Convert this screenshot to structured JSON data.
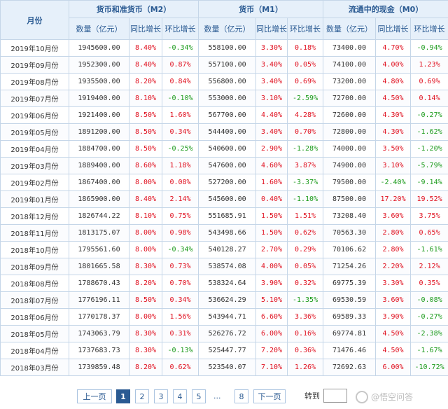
{
  "table": {
    "headers": {
      "month": "月份",
      "m2": "货币和准货币（M2）",
      "m1": "货币（M1）",
      "m0": "流通中的现金（M0）",
      "quantity": "数量（亿元）",
      "yoy": "同比增长",
      "mom": "环比增长"
    },
    "rows": [
      {
        "month": "2019年10月份",
        "m2": "1945600.00",
        "m2_yoy": "8.40%",
        "m2_mom": "-0.34%",
        "m1": "558100.00",
        "m1_yoy": "3.30%",
        "m1_mom": "0.18%",
        "m0": "73400.00",
        "m0_yoy": "4.70%",
        "m0_mom": "-0.94%"
      },
      {
        "month": "2019年09月份",
        "m2": "1952300.00",
        "m2_yoy": "8.40%",
        "m2_mom": "0.87%",
        "m1": "557100.00",
        "m1_yoy": "3.40%",
        "m1_mom": "0.05%",
        "m0": "74100.00",
        "m0_yoy": "4.00%",
        "m0_mom": "1.23%"
      },
      {
        "month": "2019年08月份",
        "m2": "1935500.00",
        "m2_yoy": "8.20%",
        "m2_mom": "0.84%",
        "m1": "556800.00",
        "m1_yoy": "3.40%",
        "m1_mom": "0.69%",
        "m0": "73200.00",
        "m0_yoy": "4.80%",
        "m0_mom": "0.69%"
      },
      {
        "month": "2019年07月份",
        "m2": "1919400.00",
        "m2_yoy": "8.10%",
        "m2_mom": "-0.10%",
        "m1": "553000.00",
        "m1_yoy": "3.10%",
        "m1_mom": "-2.59%",
        "m0": "72700.00",
        "m0_yoy": "4.50%",
        "m0_mom": "0.14%"
      },
      {
        "month": "2019年06月份",
        "m2": "1921400.00",
        "m2_yoy": "8.50%",
        "m2_mom": "1.60%",
        "m1": "567700.00",
        "m1_yoy": "4.40%",
        "m1_mom": "4.28%",
        "m0": "72600.00",
        "m0_yoy": "4.30%",
        "m0_mom": "-0.27%"
      },
      {
        "month": "2019年05月份",
        "m2": "1891200.00",
        "m2_yoy": "8.50%",
        "m2_mom": "0.34%",
        "m1": "544400.00",
        "m1_yoy": "3.40%",
        "m1_mom": "0.70%",
        "m0": "72800.00",
        "m0_yoy": "4.30%",
        "m0_mom": "-1.62%"
      },
      {
        "month": "2019年04月份",
        "m2": "1884700.00",
        "m2_yoy": "8.50%",
        "m2_mom": "-0.25%",
        "m1": "540600.00",
        "m1_yoy": "2.90%",
        "m1_mom": "-1.28%",
        "m0": "74000.00",
        "m0_yoy": "3.50%",
        "m0_mom": "-1.20%"
      },
      {
        "month": "2019年03月份",
        "m2": "1889400.00",
        "m2_yoy": "8.60%",
        "m2_mom": "1.18%",
        "m1": "547600.00",
        "m1_yoy": "4.60%",
        "m1_mom": "3.87%",
        "m0": "74900.00",
        "m0_yoy": "3.10%",
        "m0_mom": "-5.79%"
      },
      {
        "month": "2019年02月份",
        "m2": "1867400.00",
        "m2_yoy": "8.00%",
        "m2_mom": "0.08%",
        "m1": "527200.00",
        "m1_yoy": "1.60%",
        "m1_mom": "-3.37%",
        "m0": "79500.00",
        "m0_yoy": "-2.40%",
        "m0_mom": "-9.14%"
      },
      {
        "month": "2019年01月份",
        "m2": "1865900.00",
        "m2_yoy": "8.40%",
        "m2_mom": "2.14%",
        "m1": "545600.00",
        "m1_yoy": "0.40%",
        "m1_mom": "-1.10%",
        "m0": "87500.00",
        "m0_yoy": "17.20%",
        "m0_mom": "19.52%"
      },
      {
        "month": "2018年12月份",
        "m2": "1826744.22",
        "m2_yoy": "8.10%",
        "m2_mom": "0.75%",
        "m1": "551685.91",
        "m1_yoy": "1.50%",
        "m1_mom": "1.51%",
        "m0": "73208.40",
        "m0_yoy": "3.60%",
        "m0_mom": "3.75%"
      },
      {
        "month": "2018年11月份",
        "m2": "1813175.07",
        "m2_yoy": "8.00%",
        "m2_mom": "0.98%",
        "m1": "543498.66",
        "m1_yoy": "1.50%",
        "m1_mom": "0.62%",
        "m0": "70563.30",
        "m0_yoy": "2.80%",
        "m0_mom": "0.65%"
      },
      {
        "month": "2018年10月份",
        "m2": "1795561.60",
        "m2_yoy": "8.00%",
        "m2_mom": "-0.34%",
        "m1": "540128.27",
        "m1_yoy": "2.70%",
        "m1_mom": "0.29%",
        "m0": "70106.62",
        "m0_yoy": "2.80%",
        "m0_mom": "-1.61%"
      },
      {
        "month": "2018年09月份",
        "m2": "1801665.58",
        "m2_yoy": "8.30%",
        "m2_mom": "0.73%",
        "m1": "538574.08",
        "m1_yoy": "4.00%",
        "m1_mom": "0.05%",
        "m0": "71254.26",
        "m0_yoy": "2.20%",
        "m0_mom": "2.12%"
      },
      {
        "month": "2018年08月份",
        "m2": "1788670.43",
        "m2_yoy": "8.20%",
        "m2_mom": "0.70%",
        "m1": "538324.64",
        "m1_yoy": "3.90%",
        "m1_mom": "0.32%",
        "m0": "69775.39",
        "m0_yoy": "3.30%",
        "m0_mom": "0.35%"
      },
      {
        "month": "2018年07月份",
        "m2": "1776196.11",
        "m2_yoy": "8.50%",
        "m2_mom": "0.34%",
        "m1": "536624.29",
        "m1_yoy": "5.10%",
        "m1_mom": "-1.35%",
        "m0": "69530.59",
        "m0_yoy": "3.60%",
        "m0_mom": "-0.08%"
      },
      {
        "month": "2018年06月份",
        "m2": "1770178.37",
        "m2_yoy": "8.00%",
        "m2_mom": "1.56%",
        "m1": "543944.71",
        "m1_yoy": "6.60%",
        "m1_mom": "3.36%",
        "m0": "69589.33",
        "m0_yoy": "3.90%",
        "m0_mom": "-0.27%"
      },
      {
        "month": "2018年05月份",
        "m2": "1743063.79",
        "m2_yoy": "8.30%",
        "m2_mom": "0.31%",
        "m1": "526276.72",
        "m1_yoy": "6.00%",
        "m1_mom": "0.16%",
        "m0": "69774.81",
        "m0_yoy": "4.50%",
        "m0_mom": "-2.38%"
      },
      {
        "month": "2018年04月份",
        "m2": "1737683.73",
        "m2_yoy": "8.30%",
        "m2_mom": "-0.13%",
        "m1": "525447.77",
        "m1_yoy": "7.20%",
        "m1_mom": "0.36%",
        "m0": "71476.46",
        "m0_yoy": "4.50%",
        "m0_mom": "-1.67%"
      },
      {
        "month": "2018年03月份",
        "m2": "1739859.48",
        "m2_yoy": "8.20%",
        "m2_mom": "0.62%",
        "m1": "523540.07",
        "m1_yoy": "7.10%",
        "m1_mom": "1.26%",
        "m0": "72692.63",
        "m0_yoy": "6.00%",
        "m0_mom": "-10.72%"
      }
    ]
  },
  "pagination": {
    "prev_label": "上一页",
    "next_label": "下一页",
    "pages": [
      "1",
      "2",
      "3",
      "4",
      "5"
    ],
    "ellipsis": "...",
    "last_page": "8",
    "current_page": "1",
    "goto_label": "转到",
    "goto_value": ""
  },
  "watermark": {
    "text": "@悟空问答"
  },
  "colors": {
    "positive": "#e0101f",
    "negative": "#1a9a1a",
    "header_bg": "#e6f0fa",
    "header_text": "#2a5a92",
    "border": "#c5d6e8"
  }
}
